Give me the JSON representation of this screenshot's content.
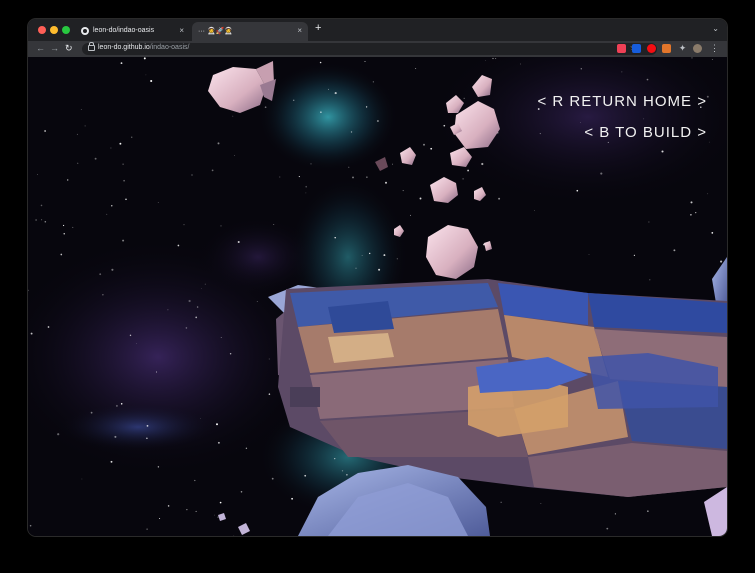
{
  "browser": {
    "tabs": [
      {
        "title": "leon-do/indao-oasis",
        "favicon": "github-icon",
        "active": false
      },
      {
        "title": "··· 🧑‍🚀🚀🧑‍🚀",
        "favicon": "",
        "active": true
      }
    ],
    "close_glyph": "×",
    "new_tab_glyph": "+",
    "tab_search_glyph": "⌄",
    "url_host": "leon-do.github.io",
    "url_path": "/indao-oasis/",
    "icons": [
      "back-arrow-icon",
      "forward-arrow-icon",
      "reload-icon",
      "lock-icon",
      "share-icon",
      "star-icon",
      "pocket-icon",
      "bitwarden-icon",
      "adblock-icon",
      "metamask-icon",
      "puzzle-icon",
      "avatar-icon",
      "menu-icon"
    ]
  },
  "game": {
    "hud": {
      "return_home": "< R RETURN HOME >",
      "to_build": "< B TO BUILD >"
    }
  },
  "colors": {
    "space": "#07060d",
    "nebula_cyan": "#2fb6c8",
    "nebula_purple": "#4a2a7a",
    "ship_blue": "#3a56a8",
    "ship_tan": "#b98a6c",
    "asteroid": "#e8c8d6"
  }
}
